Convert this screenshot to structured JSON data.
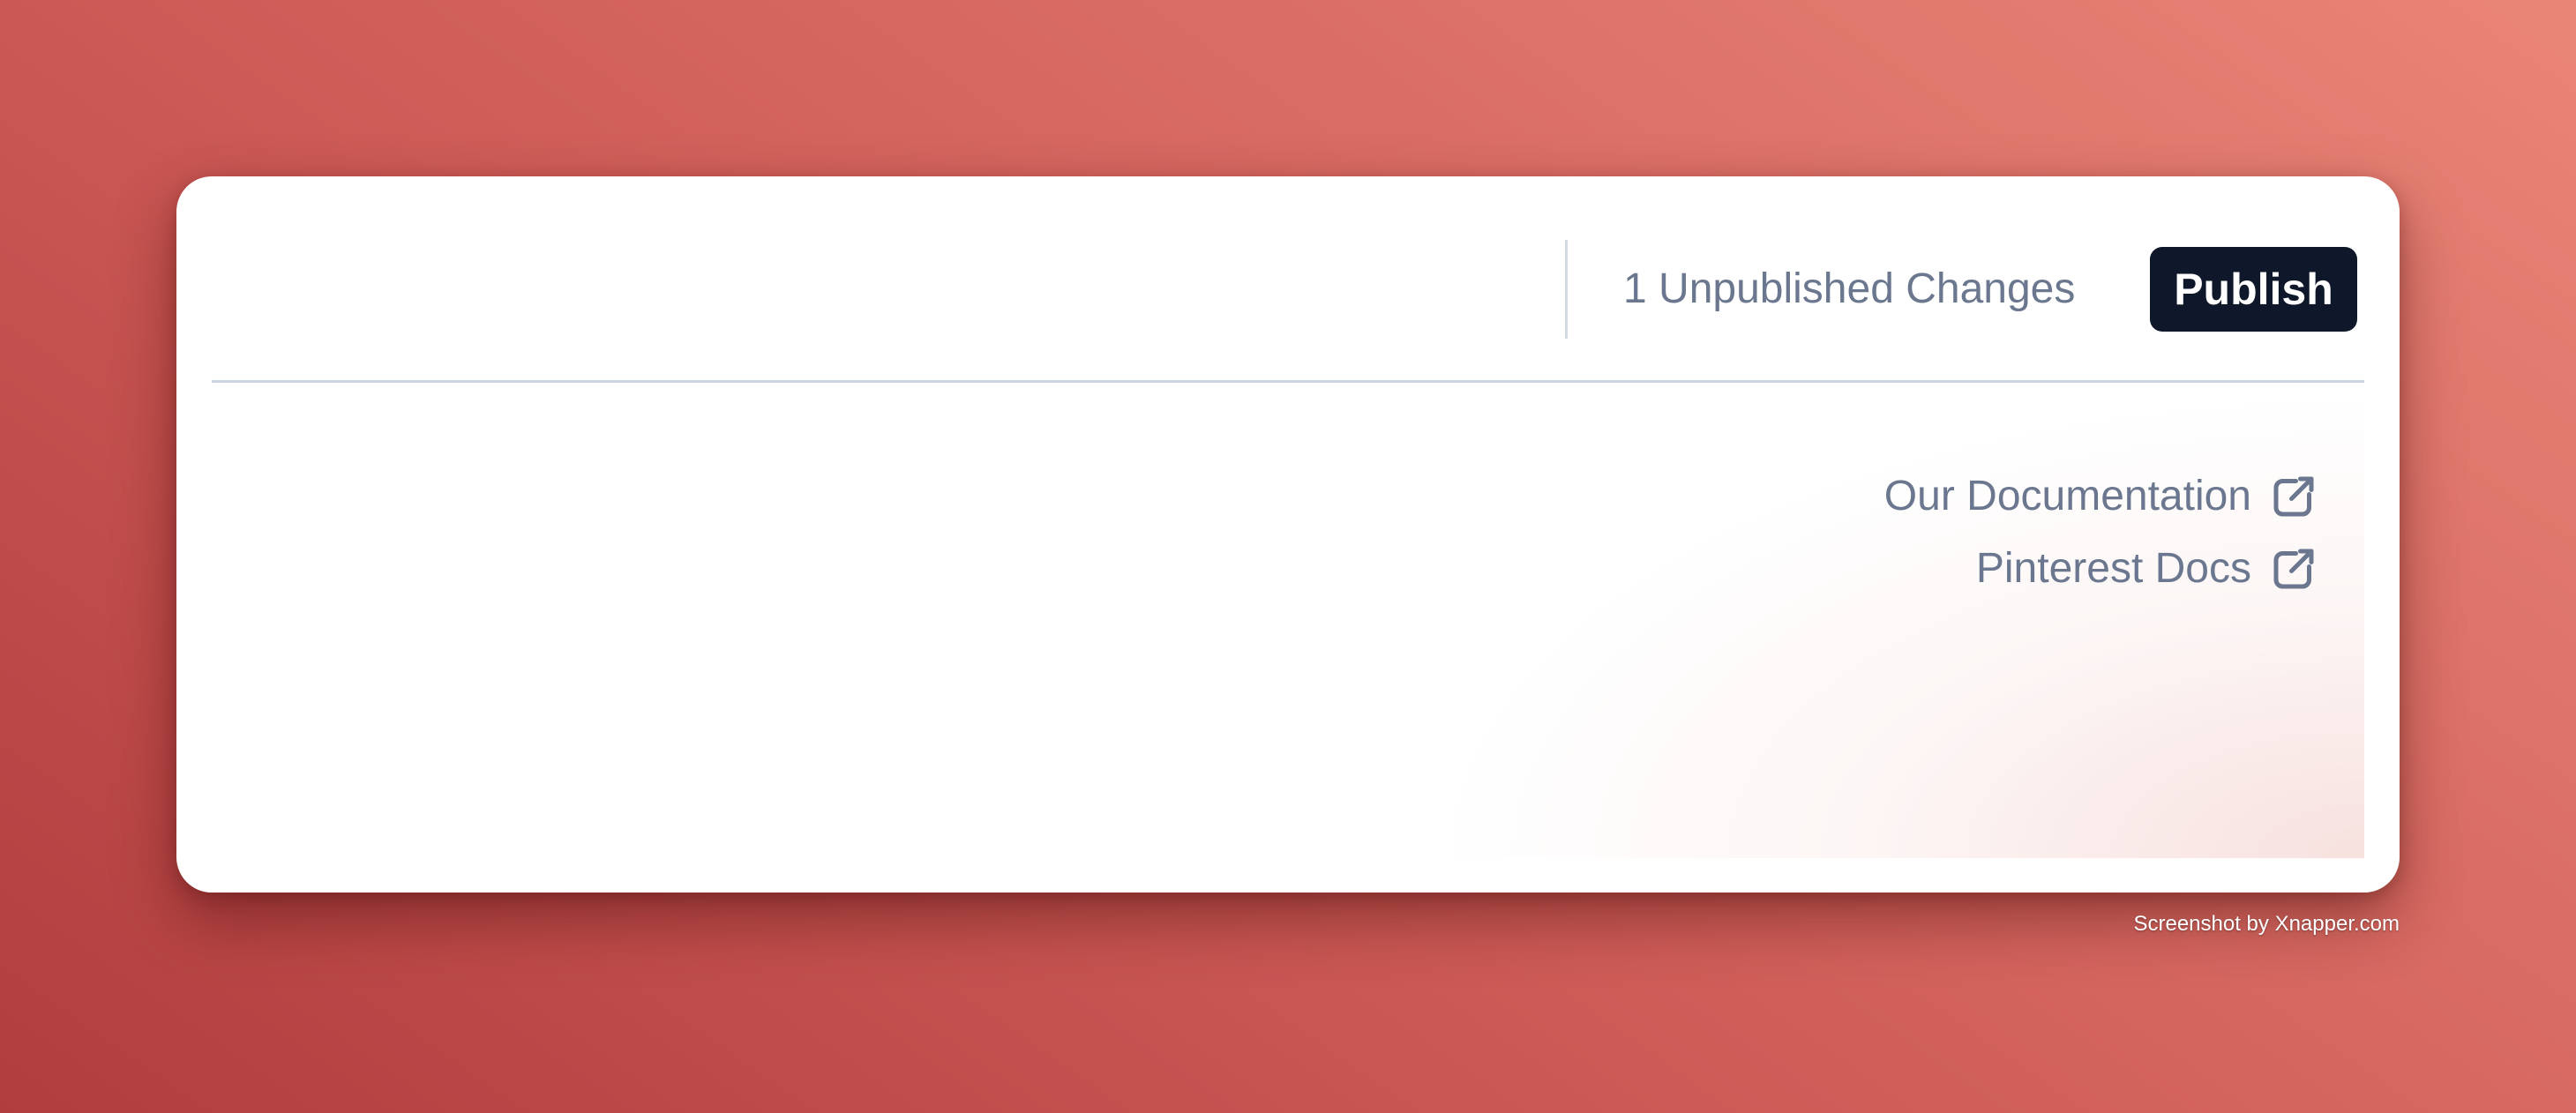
{
  "header": {
    "unpublished_changes": "1 Unpublished Changes",
    "publish_label": "Publish"
  },
  "links": [
    {
      "label": "Our Documentation",
      "icon": "external-link-icon"
    },
    {
      "label": "Pinterest Docs",
      "icon": "external-link-icon"
    }
  ],
  "footer": {
    "credit": "Screenshot by Xnapper.com"
  },
  "colors": {
    "background_start": "#b13e3f",
    "background_end": "#e98577",
    "button": "#0f172a",
    "muted_text": "#6b778f",
    "border": "#cbd5e1"
  }
}
